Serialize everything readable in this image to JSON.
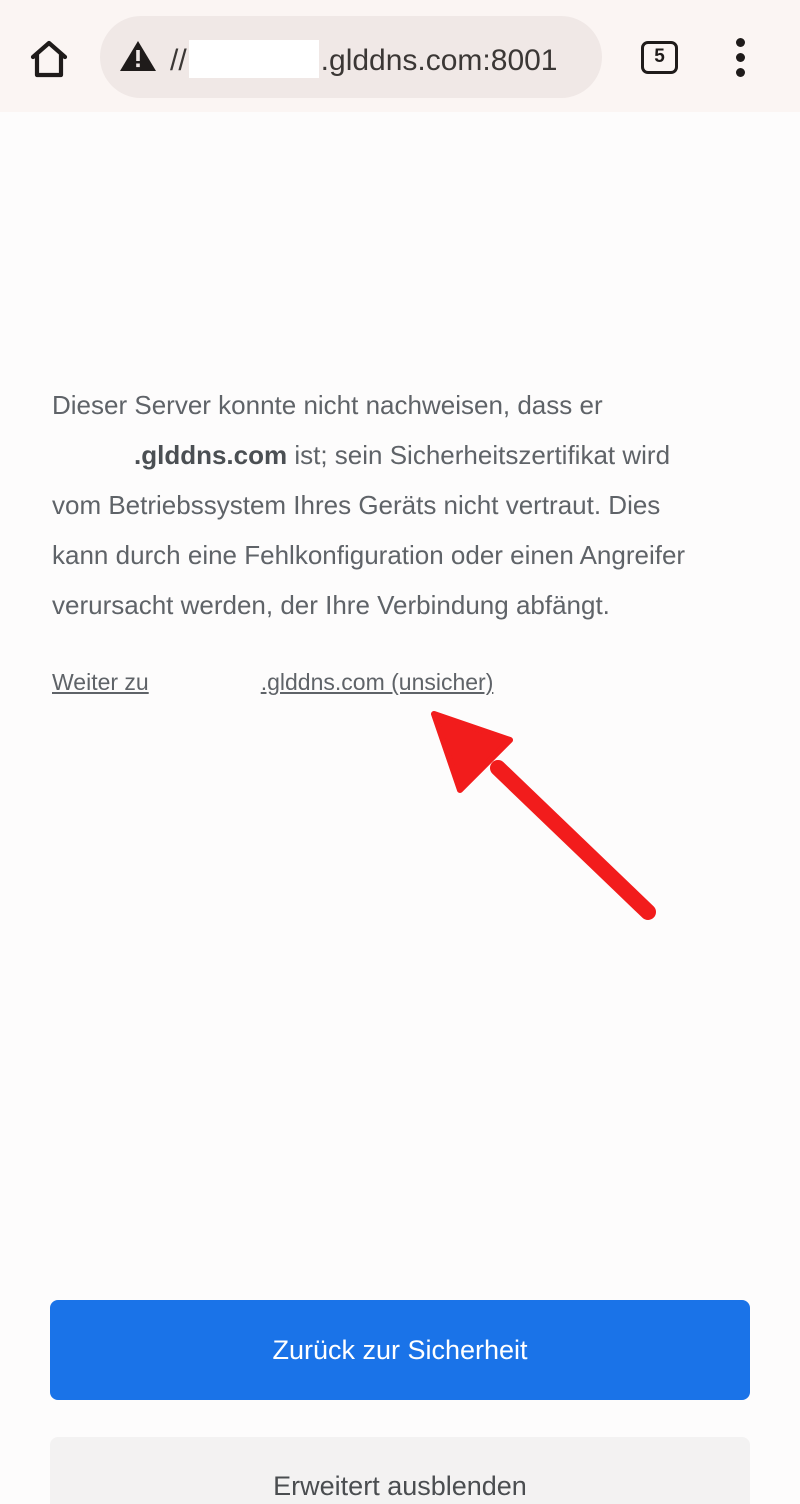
{
  "toolbar": {
    "url_prefix": "//",
    "url_host": ".glddns.com:8001",
    "tab_count": "5",
    "icons": {
      "home": "home-icon",
      "warning": "warning-triangle-icon",
      "tabs": "tab-switcher-icon",
      "menu": "more-vert-icon"
    }
  },
  "content": {
    "line1": "Dieser Server konnte nicht nachweisen, dass er",
    "domain_bold": ".glddns.com",
    "line2_rest": " ist; sein Sicherheitszertifikat wird",
    "line3": "vom Betriebssystem Ihres Geräts nicht vertraut. Dies",
    "line4": "kann durch eine Fehlkonfiguration oder einen Angreifer",
    "line5": "verursacht werden, der Ihre Verbindung abfängt."
  },
  "proceed_link": {
    "prefix": "Weiter zu",
    "suffix": ".glddns.com (unsicher)"
  },
  "buttons": {
    "back_to_safety": "Zurück zur Sicherheit",
    "hide_advanced": "Erweitert ausblenden"
  },
  "colors": {
    "primary_button": "#1a73e8",
    "annotation_arrow": "#f21c1c",
    "body_text": "#5f6368"
  }
}
